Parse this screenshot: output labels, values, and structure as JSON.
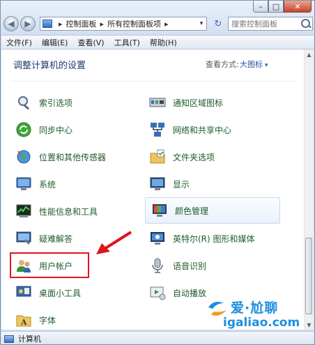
{
  "window": {
    "min": "–",
    "max": "□",
    "close": "✕"
  },
  "nav": {
    "back": "◀",
    "forward": "▶",
    "breadcrumb": [
      "控制面板",
      "所有控制面板项"
    ],
    "sep": "▸",
    "dropdown": "▾",
    "refresh": "↻",
    "search_placeholder": "搜索控制面板"
  },
  "menu": [
    "文件(F)",
    "编辑(E)",
    "查看(V)",
    "工具(T)",
    "帮助(H)"
  ],
  "content": {
    "heading": "调整计算机的设置",
    "view_by_label": "查看方式:",
    "view_by_value": "大图标"
  },
  "items": {
    "left": [
      "索引选项",
      "同步中心",
      "位置和其他传感器",
      "系统",
      "性能信息和工具",
      "疑难解答",
      "用户帐户",
      "桌面小工具",
      "字体"
    ],
    "right": [
      "通知区域图标",
      "网络和共享中心",
      "文件夹选项",
      "显示",
      "颜色管理",
      "英特尔(R) 图形和媒体",
      "语音识别",
      "自动播放"
    ]
  },
  "status_text": "计算机",
  "watermark": {
    "line1": "爱·尬聊",
    "line2": "igaliao.com"
  },
  "colors": {
    "highlight_box": "#e0141d",
    "link_text": "#1e5c28",
    "watermark": "#1c8fe0"
  }
}
